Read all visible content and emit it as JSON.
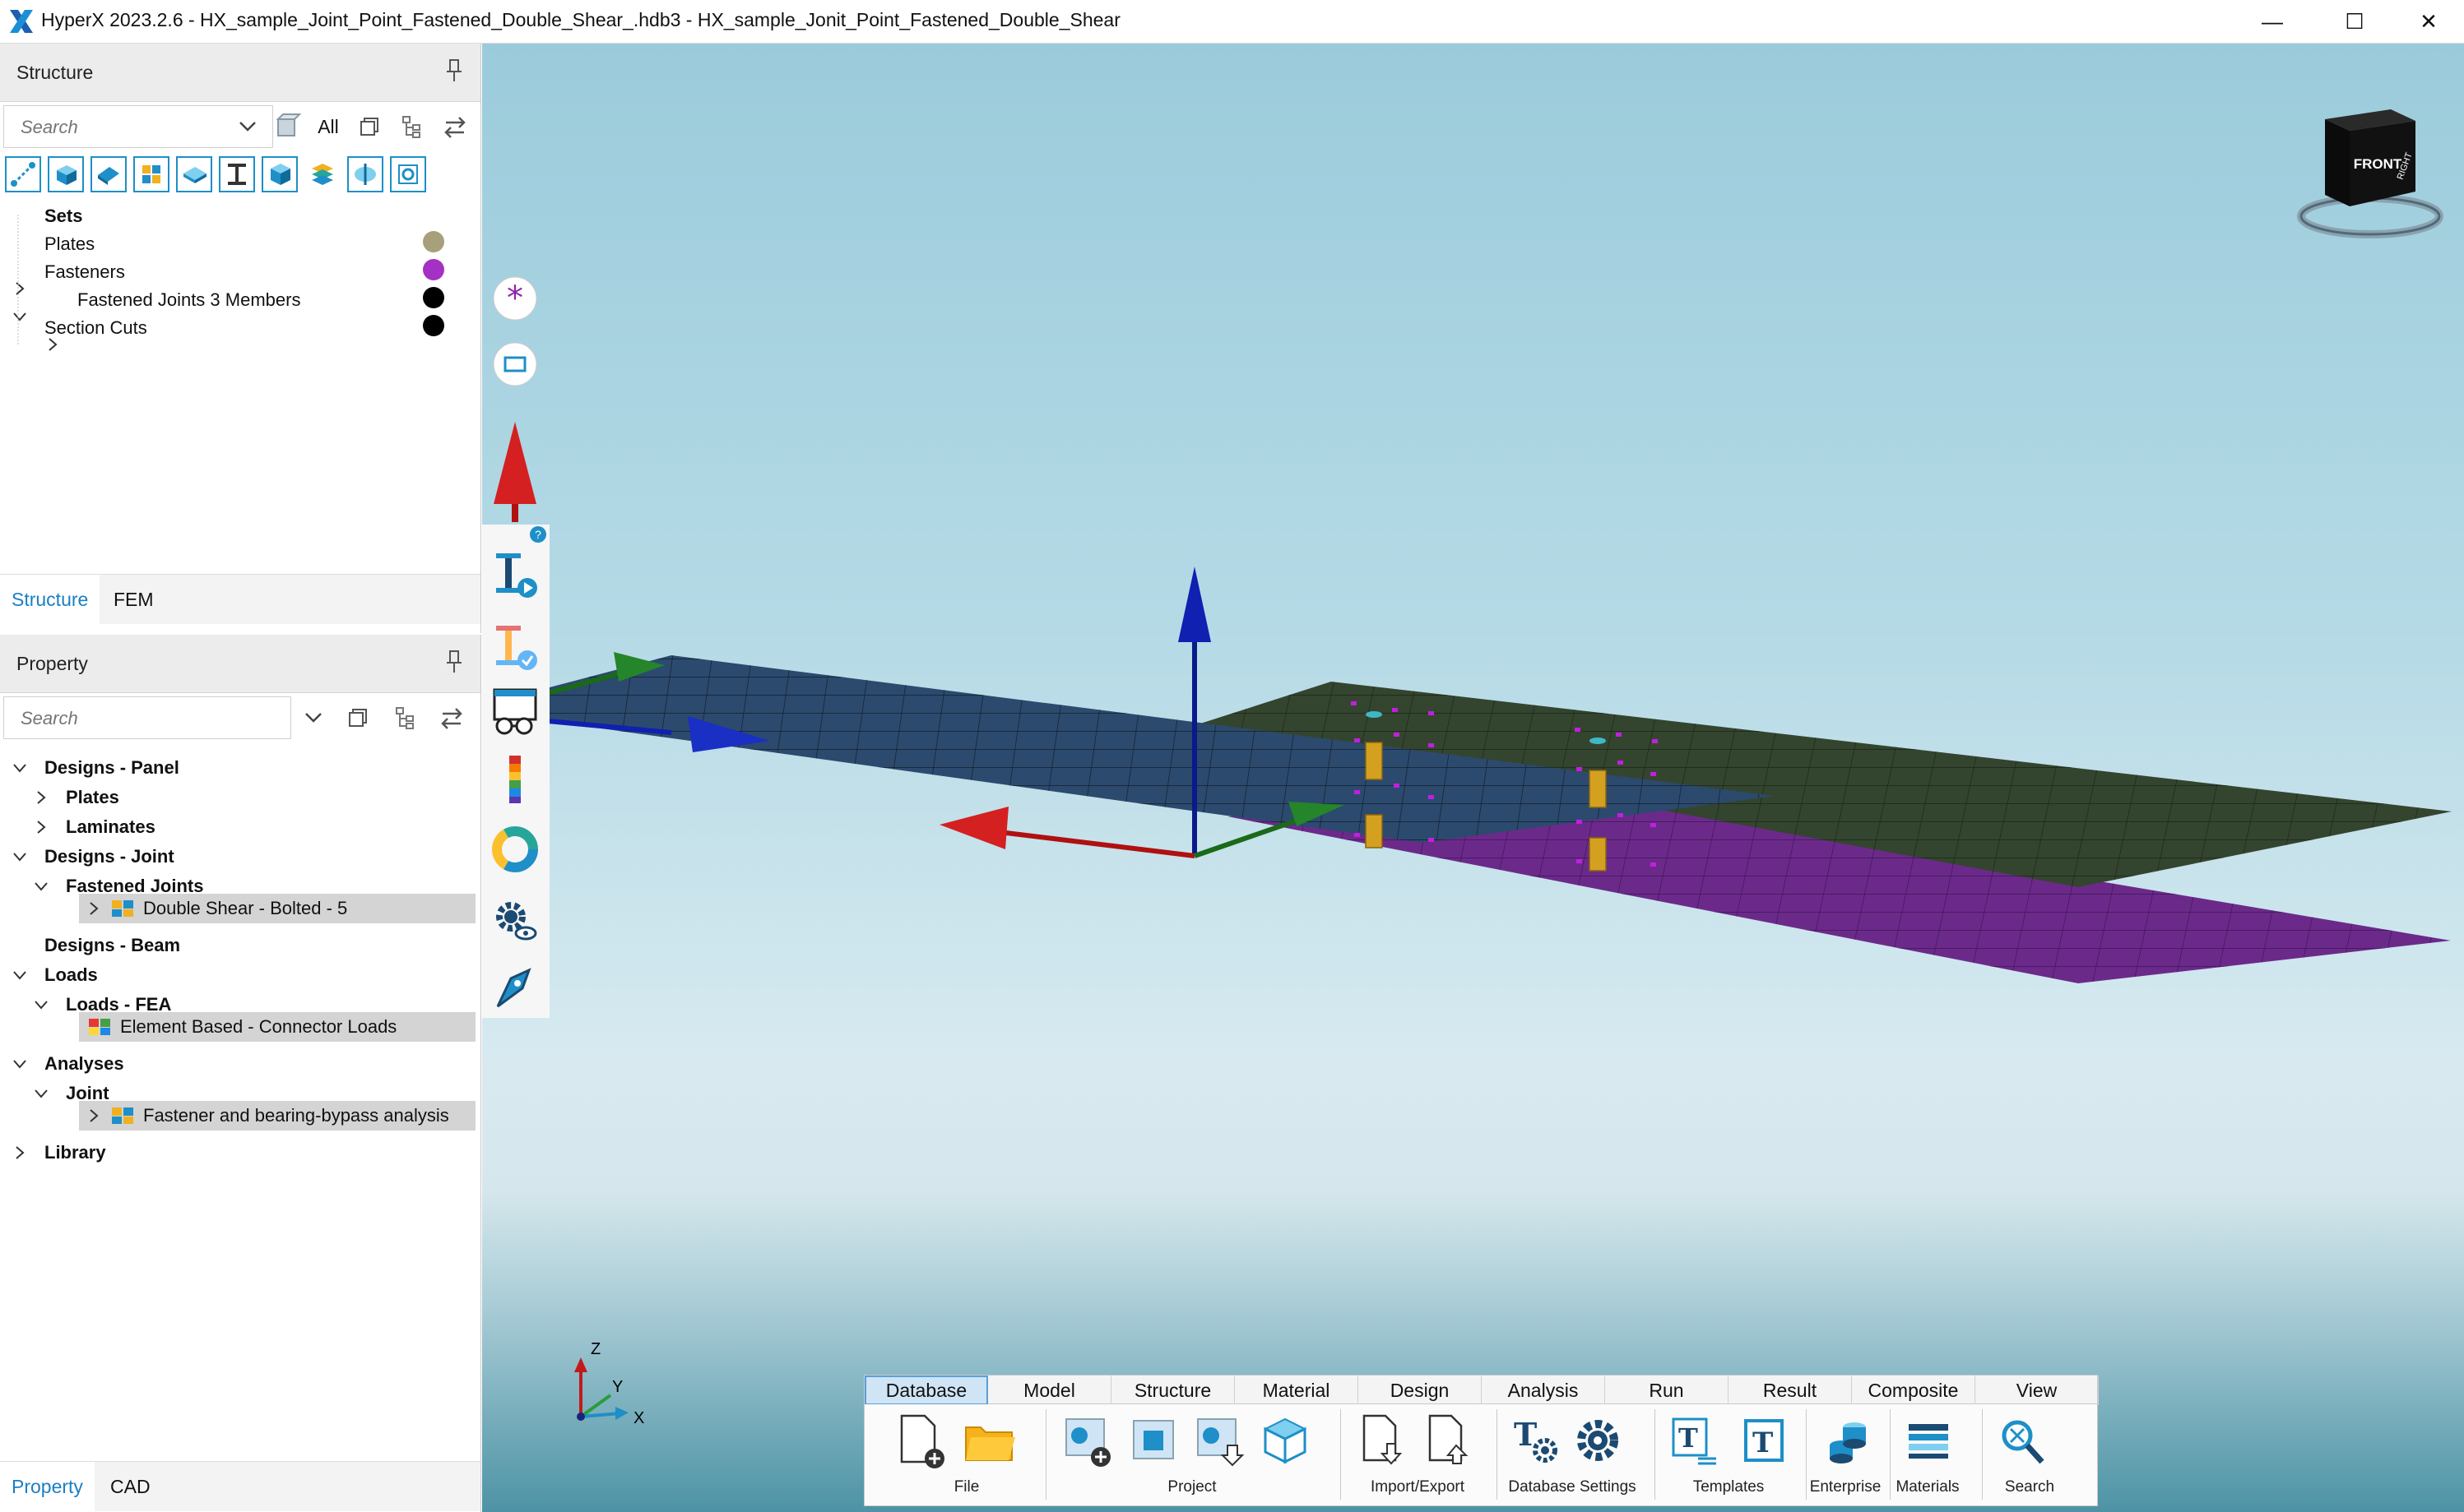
{
  "window": {
    "title": "HyperX 2023.2.6 - HX_sample_Joint_Point_Fastened_Double_Shear_.hdb3 - HX_sample_Jonit_Point_Fastened_Double_Shear",
    "minimize": "—",
    "maximize": "☐",
    "close": "✕"
  },
  "structure_pane": {
    "title": "Structure",
    "search_placeholder": "Search",
    "all_label": "All",
    "tree": [
      {
        "label": "Sets",
        "color": null
      },
      {
        "label": "Plates",
        "color": "#a8a07a"
      },
      {
        "label": "Fasteners",
        "color": "#a531c4"
      },
      {
        "label": "Fastened Joints 3 Members",
        "color": "#000000"
      },
      {
        "label": "Section Cuts",
        "color": "#000000"
      }
    ],
    "tabs": [
      "Structure",
      "FEM"
    ]
  },
  "property_pane": {
    "title": "Property",
    "search_placeholder": "Search",
    "tree": [
      {
        "label": "Designs - Panel"
      },
      {
        "label": "Plates"
      },
      {
        "label": "Laminates"
      },
      {
        "label": "Designs - Joint"
      },
      {
        "label": "Fastened Joints"
      },
      {
        "label": "Double Shear - Bolted - 5"
      },
      {
        "label": "Designs - Beam"
      },
      {
        "label": "Loads"
      },
      {
        "label": "Loads - FEA"
      },
      {
        "label": "Element Based - Connector Loads"
      },
      {
        "label": "Analyses"
      },
      {
        "label": "Joint"
      },
      {
        "label": "Fastener and bearing-bypass analysis"
      },
      {
        "label": "Library"
      }
    ],
    "tabs": [
      "Property",
      "CAD"
    ]
  },
  "viewport": {
    "view_cube": {
      "front": "FRONT",
      "right": "RIGHT"
    },
    "triad": {
      "z": "Z",
      "y": "Y",
      "x": "X"
    },
    "help_badge": "?"
  },
  "ribbon": {
    "tabs": [
      "Database",
      "Model",
      "Structure",
      "Material",
      "Design",
      "Analysis",
      "Run",
      "Result",
      "Composite",
      "View"
    ],
    "active_tab": "Database",
    "groups": [
      "File",
      "Project",
      "Import/Export",
      "Database Settings",
      "Templates",
      "Enterprise",
      "Materials",
      "Search"
    ]
  },
  "colors": {
    "accent": "#1b7fc2",
    "plate_blue": "#2c4a6e",
    "plate_green": "#34452f",
    "plate_purple": "#6b2a8a",
    "fastener": "#d4a020"
  }
}
